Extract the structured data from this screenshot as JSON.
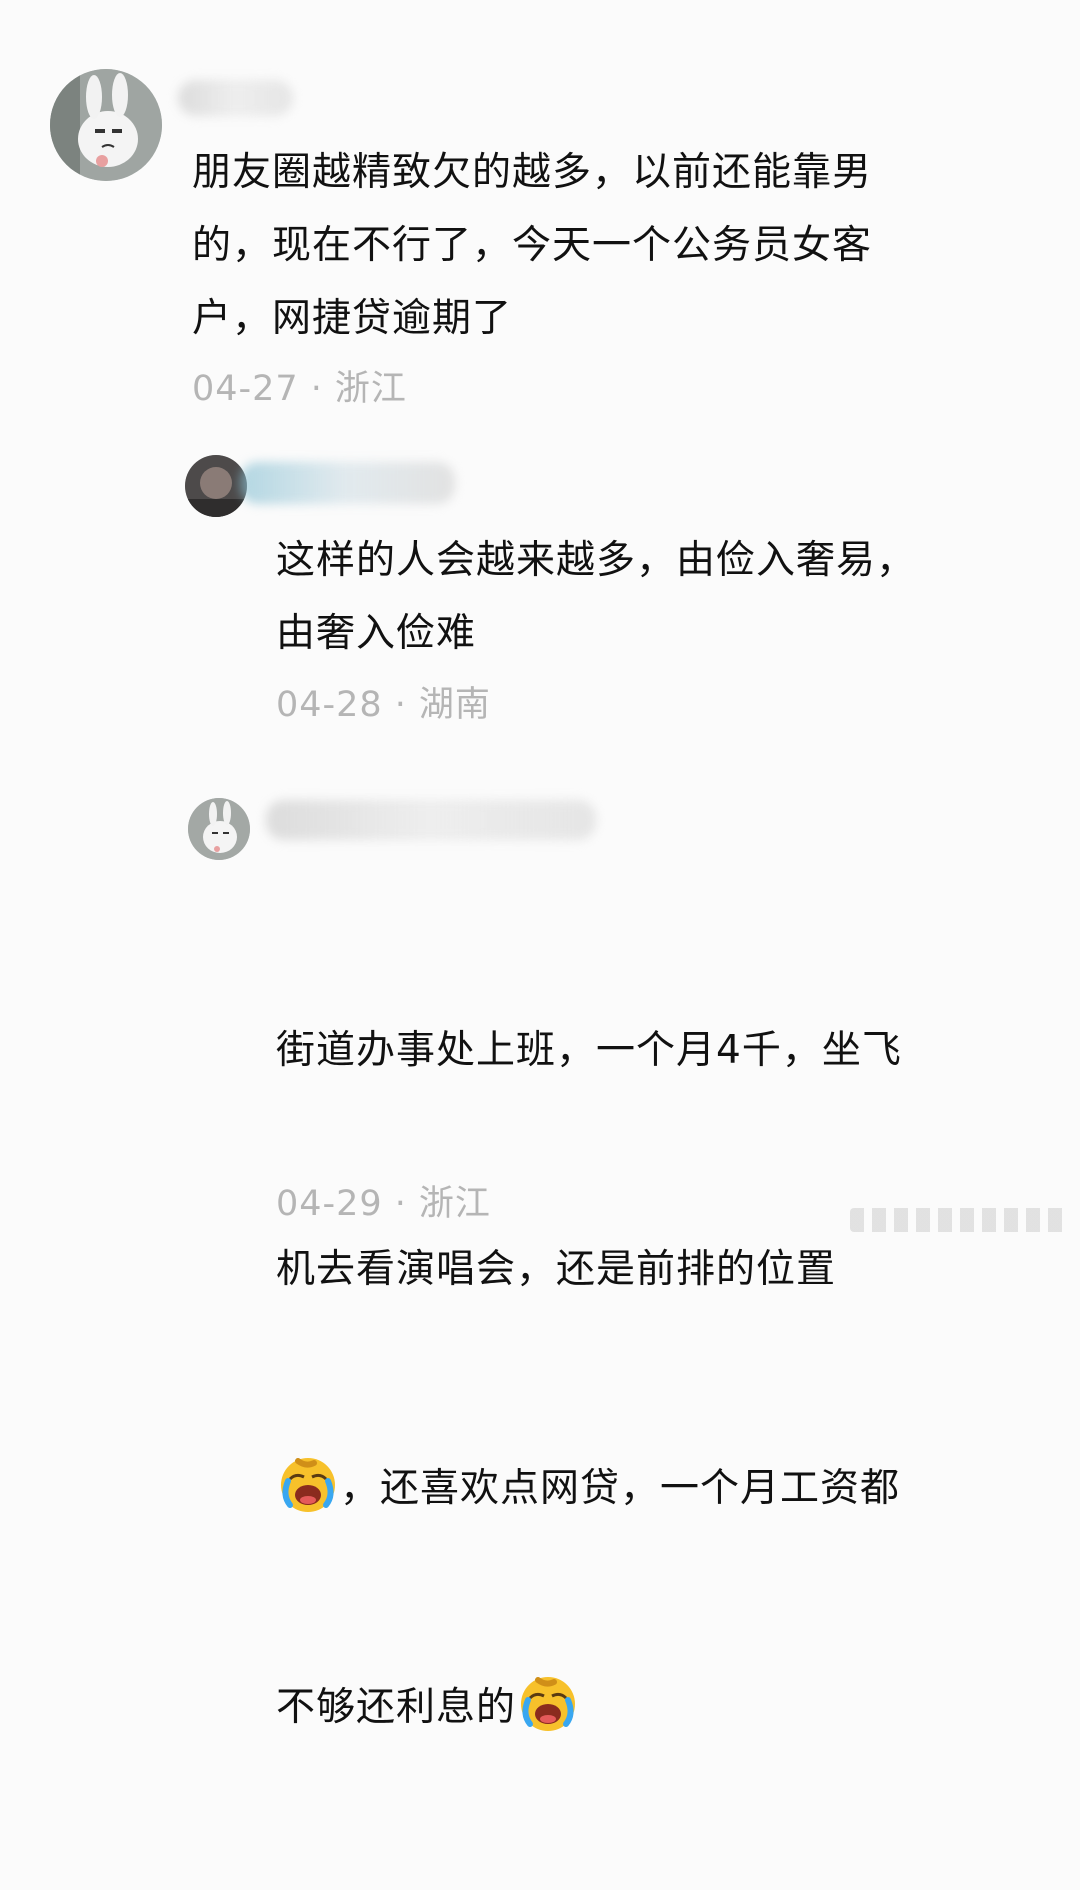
{
  "comments": [
    {
      "text": "朋友圈越精致欠的越多，以前还能靠男\n的，现在不行了，今天一个公务员女客\n户，网捷贷逾期了",
      "date": "04-27",
      "location": "浙江"
    },
    {
      "text": "这样的人会越来越多，由俭入奢易，\n由奢入俭难",
      "date": "04-28",
      "location": "湖南"
    },
    {
      "line1": "街道办事处上班，一个月4千，坐飞",
      "line2": "机去看演唱会，还是前排的位置",
      "line3_after_emoji": "，还喜欢点网贷，一个月工资都",
      "line4_before_emoji": "不够还利息的",
      "emoji": "loudly-crying-face",
      "date": "04-29",
      "location": "浙江"
    }
  ],
  "separator": "·",
  "colors": {
    "background": "#fbfbfb",
    "text": "#111111",
    "meta": "#b5b5b5"
  }
}
